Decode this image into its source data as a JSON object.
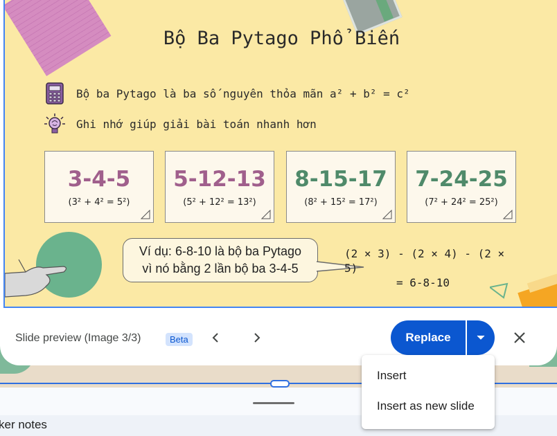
{
  "slide": {
    "title": "Bộ Ba Pytago Phổ Biến",
    "bullet1_icon": "calculator-icon",
    "bullet1": "Bộ ba Pytago là ba số nguyên thỏa mãn a² + b² = c²",
    "bullet2_icon": "lightbulb-brain-icon",
    "bullet2": "Ghi nhớ giúp giải bài toán nhanh hơn",
    "cards": [
      {
        "big": "3-4-5",
        "small": "(3² + 4² = 5²)",
        "color": "#a05f8c",
        "shadow": "#d7a3c4"
      },
      {
        "big": "5-12-13",
        "small": "(5² + 12² = 13²)",
        "color": "#a05f8c",
        "shadow": "#d7a3c4"
      },
      {
        "big": "8-15-17",
        "small": "(8² + 15² = 17²)",
        "color": "#4f8a6a",
        "shadow": "#82b596"
      },
      {
        "big": "7-24-25",
        "small": "(7² + 24² = 25²)",
        "color": "#4f8a6a",
        "shadow": "#9ccdb3"
      }
    ],
    "bubble_line1": "Ví dụ: 6-8-10 là bộ ba Pytago",
    "bubble_line2": "vì nó bằng 2 lần bộ ba 3-4-5",
    "calc_line1": "(2 × 3) - (2 × 4) - (2 × 5)",
    "calc_line2": "= 6-8-10"
  },
  "footer": {
    "preview_label": "Slide preview (Image 3/3)",
    "beta": "Beta",
    "prev_icon": "chevron-left-icon",
    "next_icon": "chevron-right-icon",
    "replace": "Replace",
    "dropdown_icon": "caret-down-icon",
    "close_icon": "close-icon"
  },
  "menu": {
    "items": [
      "Insert",
      "Insert as new slide"
    ]
  },
  "notes": {
    "label": "ker notes"
  },
  "colors": {
    "accent": "#0b57d0",
    "slide_bg": "#fbe9a5",
    "selection": "#2f6fe0"
  }
}
